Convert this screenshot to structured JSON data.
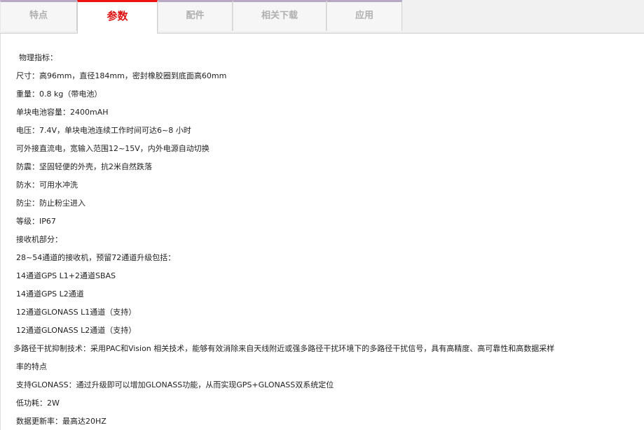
{
  "tabs": [
    {
      "label": "特点"
    },
    {
      "label": "参数"
    },
    {
      "label": "配件"
    },
    {
      "label": "相关下载"
    },
    {
      "label": "应用"
    }
  ],
  "content": {
    "lines": [
      " 物理指标：",
      "尺寸：高96mm，直径184mm，密封橡胶圈到底面高60mm",
      "重量：0.8 kg（带电池）",
      "单块电池容量：2400mAH",
      "电压：7.4V，单块电池连续工作时间可达6~8 小时",
      "可外接直流电，宽输入范围12~15V，内外电源自动切换",
      "防震：坚固轻便的外壳，抗2米自然跌落",
      "防水：可用水冲洗",
      "防尘：防止粉尘进入",
      "等级：IP67",
      "接收机部分：",
      "28~54通道的接收机，预留72通道升级包括：",
      "14通道GPS  L1+2通道SBAS",
      "14通道GPS  L2通道",
      "12通道GLONASS  L1通道（支持）",
      "12通道GLONASS  L2通道（支持）",
      "多路径干扰抑制技术：采用PAC和Vision 相关技术，能够有效消除来自天线附近或强多路径干扰环境下的多路径干扰信号，具有高精度、高可靠性和高数据采样",
      "率的特点",
      "支持GLONASS：通过升级即可以增加GLONASS功能，从而实现GPS+GLONASS双系统定位",
      "低功耗：2W",
      "数据更新率：最高达20HZ"
    ]
  }
}
